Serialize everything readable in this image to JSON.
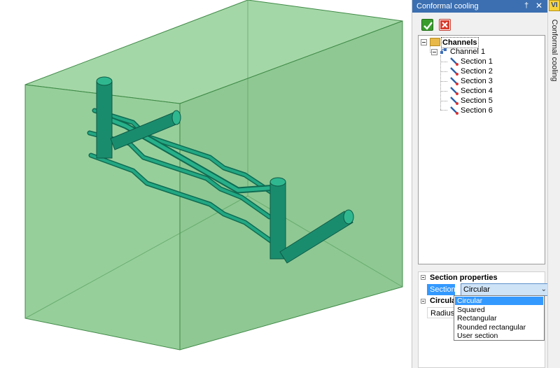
{
  "window": {
    "title": "Conformal cooling",
    "pin_glyph": "†",
    "close_glyph": "✕"
  },
  "toolbar": {
    "ok_icon": "checkmark-icon",
    "cancel_icon": "red-x-icon"
  },
  "tree": {
    "root": {
      "label": "Channels",
      "icon": "folder-icon"
    },
    "channel": {
      "label": "Channel 1",
      "icon": "channel-icon"
    },
    "sections": [
      {
        "label": "Section 1",
        "icon": "section-pipe-icon"
      },
      {
        "label": "Section 2",
        "icon": "section-pipe-icon"
      },
      {
        "label": "Section 3",
        "icon": "section-pipe-icon"
      },
      {
        "label": "Section 4",
        "icon": "section-pipe-icon"
      },
      {
        "label": "Section 5",
        "icon": "section-pipe-icon"
      },
      {
        "label": "Section 6",
        "icon": "section-pipe-icon"
      }
    ]
  },
  "properties": {
    "category1": "Section properties",
    "section_label": "Section",
    "section_value": "Circular",
    "category2": "Circular s",
    "radius_label": "Radius"
  },
  "dropdown": {
    "options": [
      "Circular",
      "Squared",
      "Rectangular",
      "Rounded rectangular",
      "User section"
    ],
    "selected_index": 0
  },
  "side": {
    "badge": "VI",
    "tab_label": "Conformal cooling"
  },
  "colors": {
    "mold_block": "#7cc47f",
    "pipe": "#1a8c6e",
    "title_bar": "#3b6fb1",
    "selection": "#3399ff"
  }
}
